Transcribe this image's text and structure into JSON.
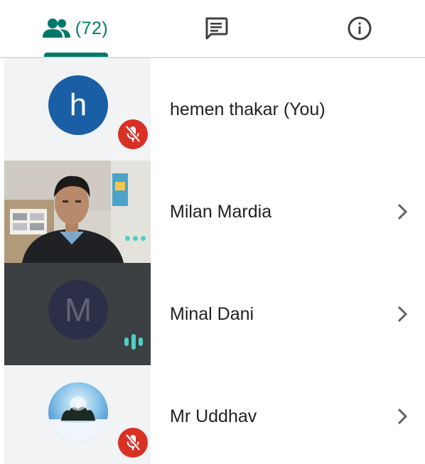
{
  "tabs": {
    "people": {
      "icon": "people-icon",
      "count_label": "(72)"
    },
    "chat": {
      "icon": "chat-message-icon"
    },
    "info": {
      "icon": "info-icon"
    },
    "active": "people"
  },
  "colors": {
    "accent": "#00796b",
    "mute_red": "#d93025",
    "audio_teal": "#4dd0c4",
    "avatar_blue": "#1a5ea6"
  },
  "participants": [
    {
      "name": "hemen thakar (You)",
      "avatar_letter": "h",
      "tile": "letter-avatar",
      "status_icon": "mic-off-icon",
      "has_chevron": false
    },
    {
      "name": "Milan Mardia",
      "tile": "video",
      "status_icon": "more-dots-icon",
      "has_chevron": true
    },
    {
      "name": "Minal Dani",
      "avatar_letter": "M",
      "tile": "letter-avatar-dark",
      "status_icon": "audio-level-icon",
      "has_chevron": true
    },
    {
      "name": "Mr Uddhav",
      "tile": "photo-avatar",
      "status_icon": "mic-off-icon",
      "has_chevron": true
    }
  ]
}
